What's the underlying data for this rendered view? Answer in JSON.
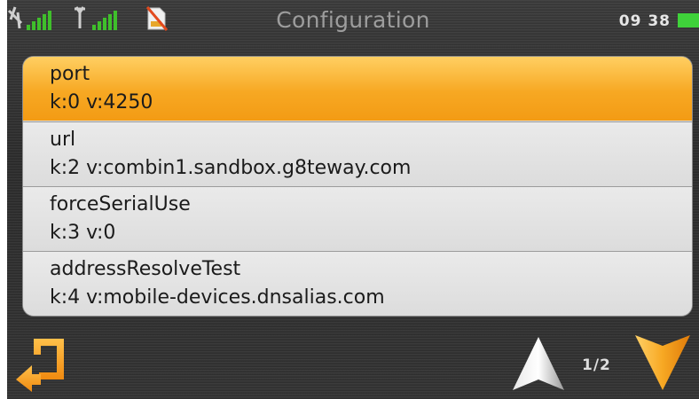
{
  "status": {
    "title": "Configuration",
    "time": "09 38",
    "battery_color": "#3fd23a"
  },
  "items": [
    {
      "name": "port",
      "value": "k:0 v:4250",
      "selected": true
    },
    {
      "name": "url",
      "value": "k:2 v:combin1.sandbox.g8teway.com",
      "selected": false
    },
    {
      "name": "forceSerialUse",
      "value": "k:3 v:0",
      "selected": false
    },
    {
      "name": "addressResolveTest",
      "value": "k:4 v:mobile-devices.dnsalias.com",
      "selected": false
    }
  ],
  "nav": {
    "page_indicator": "1/2",
    "back_icon": "back-arrow-icon",
    "up_icon": "up-arrow-icon",
    "down_icon": "down-arrow-icon"
  },
  "colors": {
    "accent": "#f7a823",
    "signal": "#3fbf2b",
    "nosim": "#e24a1e"
  }
}
